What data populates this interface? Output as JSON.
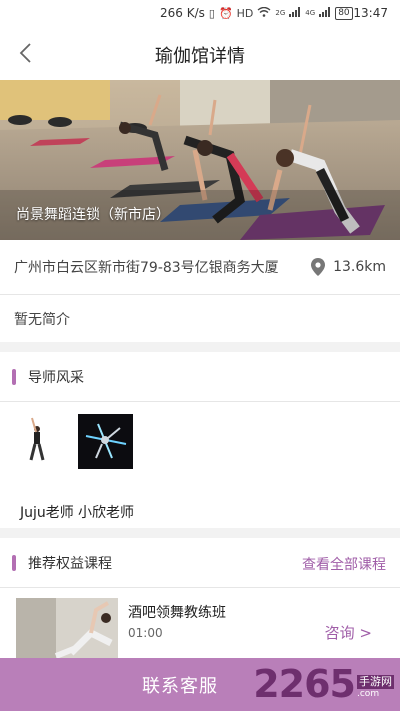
{
  "status_bar": {
    "network_speed": "266 K/s",
    "signal_1": "2G",
    "signal_2": "4G",
    "battery": "80",
    "time": "13:47",
    "icons": [
      "vibrate-icon",
      "alarm-icon",
      "hd-icon",
      "wifi-icon",
      "signal-icon",
      "battery-icon"
    ]
  },
  "nav": {
    "title": "瑜伽馆详情",
    "back_icon": "chevron-left-icon"
  },
  "venue": {
    "name": "尚景舞蹈连锁（新市店）",
    "address": "广州市白云区新市街79-83号亿银商务大厦",
    "distance": "13.6km",
    "location_icon": "location-pin-icon",
    "intro": "暂无简介"
  },
  "teachers_section": {
    "title": "导师风采",
    "teachers": [
      {
        "name": "Juju老师"
      },
      {
        "name": "小欣老师"
      }
    ]
  },
  "courses_section": {
    "title": "推荐权益课程",
    "view_all": "查看全部课程",
    "courses": [
      {
        "title": "酒吧领舞教练班",
        "time": "01:00",
        "action": "咨询  >"
      }
    ]
  },
  "bottom": {
    "contact_label": "联系客服"
  },
  "watermark": {
    "number": "2265",
    "cn": "手游网",
    "url": ".com"
  },
  "colors": {
    "accent": "#b36fb3",
    "bottom_bar": "#b97fb9",
    "link": "#a05ea8"
  }
}
